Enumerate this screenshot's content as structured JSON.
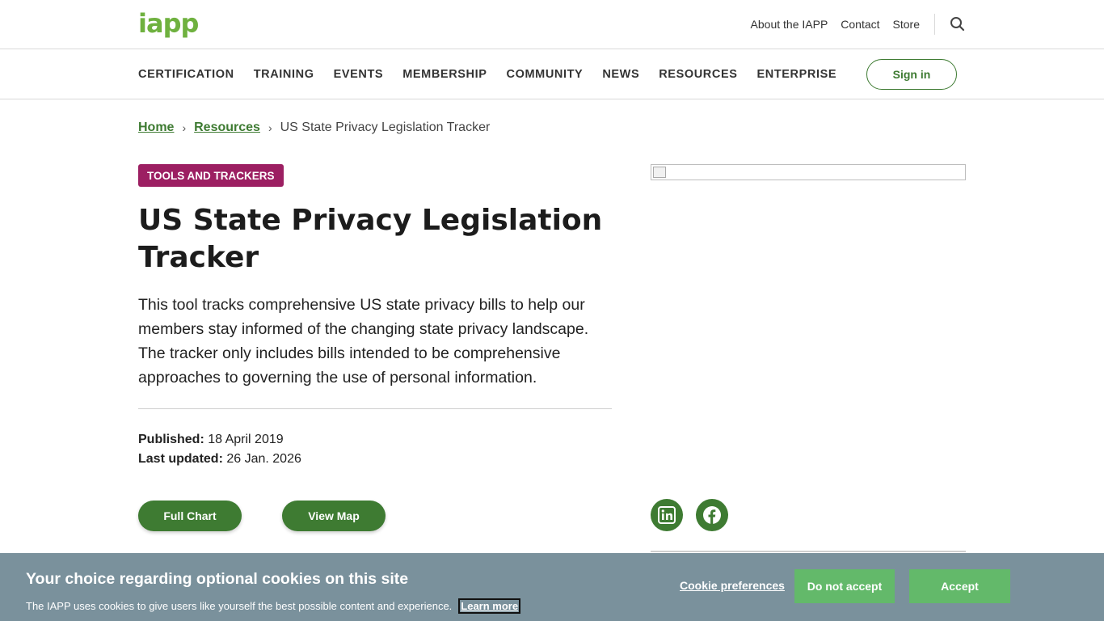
{
  "header": {
    "logo_text": "iapp",
    "utility_links": [
      "About the IAPP",
      "Contact",
      "Store"
    ],
    "search_icon": "search-icon",
    "brand_color": "#6fb13f"
  },
  "nav": {
    "items": [
      "CERTIFICATION",
      "TRAINING",
      "EVENTS",
      "MEMBERSHIP",
      "COMMUNITY",
      "NEWS",
      "RESOURCES",
      "ENTERPRISE"
    ],
    "signin_label": "Sign in"
  },
  "breadcrumb": {
    "home": "Home",
    "resources": "Resources",
    "current": "US State Privacy Legislation Tracker"
  },
  "article": {
    "tag": "TOOLS AND TRACKERS",
    "tag_color": "#9c1f62",
    "title": "US State Privacy Legislation Tracker",
    "intro": "This tool tracks comprehensive US state privacy bills to help our members stay informed of the changing state privacy landscape. The tracker only includes bills intended to be comprehensive approaches to governing the use of personal information.",
    "published_label": "Published:",
    "published_value": "18 April 2019",
    "updated_label": "Last updated:",
    "updated_value": "26 Jan. 2026",
    "full_chart_label": "Full Chart",
    "view_map_label": "View Map",
    "accent_color": "#3e7b32"
  },
  "sidebar": {
    "social": [
      "linkedin-icon",
      "facebook-icon"
    ]
  },
  "cookie_banner": {
    "heading": "Your choice regarding optional cookies on this site",
    "text": "The IAPP uses cookies to give users like yourself the best possible content and experience.",
    "learn_more": "Learn more",
    "preferences": "Cookie preferences",
    "reject": "Do not accept",
    "accept": "Accept",
    "background": "#7a919c",
    "button_color": "#63b96a"
  }
}
